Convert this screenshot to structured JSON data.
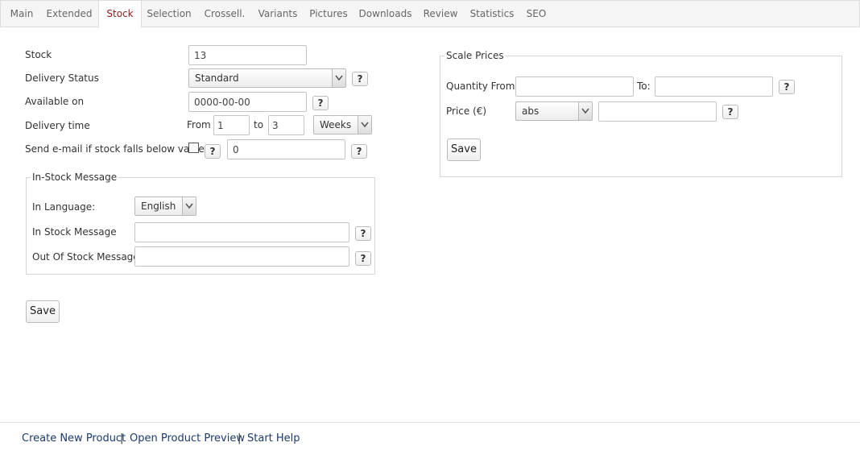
{
  "tabs": [
    {
      "label": "Main"
    },
    {
      "label": "Extended"
    },
    {
      "label": "Stock"
    },
    {
      "label": "Selection"
    },
    {
      "label": "Crossell."
    },
    {
      "label": "Variants"
    },
    {
      "label": "Pictures"
    },
    {
      "label": "Downloads"
    },
    {
      "label": "Review"
    },
    {
      "label": "Statistics"
    },
    {
      "label": "SEO"
    }
  ],
  "active_tab": "Stock",
  "colors": {
    "active_tab_text": "#8b1a1a",
    "link": "#1a3a6b"
  },
  "stock_form": {
    "stock_label": "Stock",
    "stock_value": "13",
    "delivery_status_label": "Delivery Status",
    "delivery_status_value": "Standard",
    "available_on_label": "Available on",
    "available_on_value": "0000-00-00",
    "delivery_time_label": "Delivery time",
    "from_label": "From",
    "from_value": "1",
    "to_label": "to",
    "to_value": "3",
    "unit_value": "Weeks",
    "email_label": "Send e-mail if stock falls below value",
    "email_checked": false,
    "email_threshold_value": "0",
    "help_label": "?"
  },
  "in_stock_message": {
    "legend": "In-Stock Message",
    "language_label": "In Language:",
    "language_value": "English",
    "in_stock_label": "In Stock Message",
    "in_stock_value": "",
    "out_of_stock_label": "Out Of Stock Message",
    "out_of_stock_value": ""
  },
  "save_label": "Save",
  "scale_prices": {
    "legend": "Scale Prices",
    "quantity_from_label": "Quantity From:",
    "quantity_from_value": "",
    "to_label": "To:",
    "to_value": "",
    "price_label": "Price (€)",
    "price_type_value": "abs",
    "price_value": "",
    "save_label": "Save"
  },
  "footer": {
    "create_label": "Create New Product",
    "preview_label": "Open Product Preview",
    "help_label": "Start Help",
    "separator": "|"
  }
}
